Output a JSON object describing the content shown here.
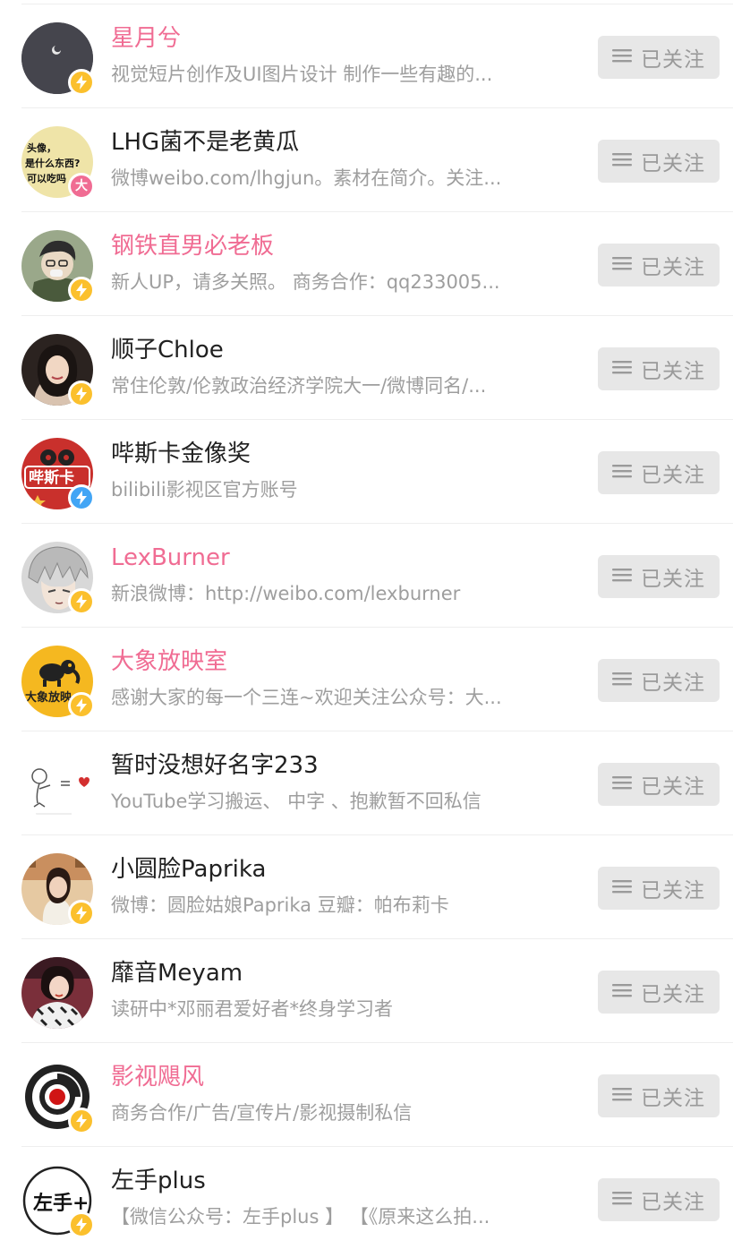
{
  "colors": {
    "vip_name": "#f06c93",
    "normal_name": "#212121",
    "desc": "#9e9e9e",
    "button_bg": "#e7e7e7",
    "button_text": "#9a9a9a",
    "badge_yellow": "#fbc02d",
    "badge_blue": "#42a5f5",
    "badge_pink": "#f06c93"
  },
  "follow_label": "已关注",
  "users": [
    {
      "name": "星月兮",
      "vip": true,
      "desc": "视觉短片创作及UI图片设计 制作一些有趣的...",
      "badge": "lightning-yellow"
    },
    {
      "name": "LHG菌不是老黄瓜",
      "vip": false,
      "desc": "微博weibo.com/lhgjun。素材在简介。关注...",
      "badge": "text-pink",
      "badge_text": "大",
      "avatar_text": [
        "头像，",
        "是什么东西?",
        "可以吃吗"
      ]
    },
    {
      "name": "钢铁直男必老板",
      "vip": true,
      "desc": "新人UP，请多关照。 商务合作：qq233005...",
      "badge": "lightning-yellow"
    },
    {
      "name": "顺子Chloe",
      "vip": false,
      "desc": "常住伦敦/伦敦政治经济学院大一/微博同名/...",
      "badge": "lightning-yellow"
    },
    {
      "name": "哔斯卡金像奖",
      "vip": false,
      "desc": "bilibili影视区官方账号",
      "badge": "lightning-blue",
      "avatar_text": [
        "哔斯卡"
      ]
    },
    {
      "name": "LexBurner",
      "vip": true,
      "desc": "新浪微博：http://weibo.com/lexburner",
      "badge": "lightning-yellow"
    },
    {
      "name": "大象放映室",
      "vip": true,
      "desc": "感谢大家的每一个三连~欢迎关注公众号：大...",
      "badge": "lightning-yellow",
      "avatar_text": [
        "大象放映"
      ]
    },
    {
      "name": "暂时没想好名字233",
      "vip": false,
      "desc": "YouTube学习搬运、 中字 、抱歉暂不回私信",
      "badge": "none"
    },
    {
      "name": "小圆脸Paprika",
      "vip": false,
      "desc": "微博：圆脸姑娘Paprika 豆瓣：帕布莉卡",
      "badge": "lightning-yellow"
    },
    {
      "name": "靡音Meyam",
      "vip": false,
      "desc": "读研中*邓丽君爱好者*终身学习者",
      "badge": "none"
    },
    {
      "name": "影视飓风",
      "vip": true,
      "desc": "商务合作/广告/宣传片/影视摄制私信",
      "badge": "lightning-yellow"
    },
    {
      "name": "左手plus",
      "vip": false,
      "desc": "【微信公众号：左手plus 】 【《原来这么拍...",
      "badge": "lightning-yellow",
      "avatar_text": [
        "左手+"
      ]
    }
  ]
}
